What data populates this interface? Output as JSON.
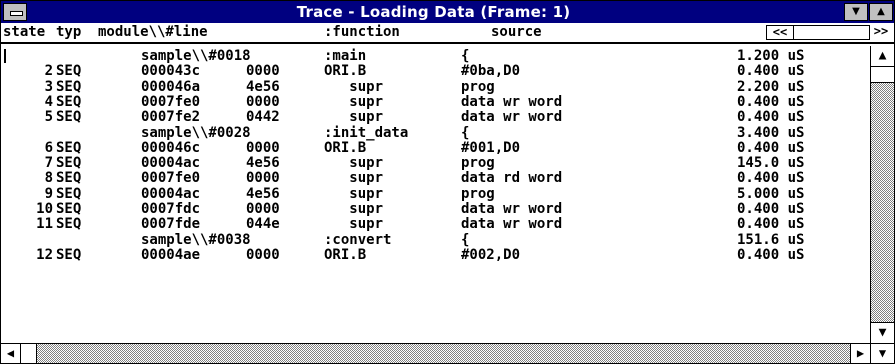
{
  "window": {
    "title": "Trace - Loading Data (Frame: 1)",
    "sys_menu_icon": "system-menu-icon",
    "minimize_glyph": "▼",
    "maximize_glyph": "▲"
  },
  "header": {
    "state": "state",
    "typ": "typ",
    "module_line": "module\\\\#line",
    "function": ":function",
    "source": "source",
    "scroll_left": "<<",
    "scroll_right": ">>"
  },
  "rows": [
    {
      "state": "",
      "typ": "",
      "addr": "sample\\\\#0018",
      "data": "",
      "op": ":main",
      "src": "{",
      "time": "1.200 uS"
    },
    {
      "state": "2",
      "typ": "SEQ",
      "addr": "000043c",
      "data": "0000",
      "op": "ORI.B",
      "src": "#0ba,D0",
      "time": "0.400 uS"
    },
    {
      "state": "3",
      "typ": "SEQ",
      "addr": "000046a",
      "data": "4e56",
      "op": "   supr",
      "src": "prog",
      "time": "2.200 uS"
    },
    {
      "state": "4",
      "typ": "SEQ",
      "addr": "0007fe0",
      "data": "0000",
      "op": "   supr",
      "src": "data wr word",
      "time": "0.400 uS"
    },
    {
      "state": "5",
      "typ": "SEQ",
      "addr": "0007fe2",
      "data": "0442",
      "op": "   supr",
      "src": "data wr word",
      "time": "0.400 uS"
    },
    {
      "state": "",
      "typ": "",
      "addr": "sample\\\\#0028",
      "data": "",
      "op": ":init_data",
      "src": "{",
      "time": "3.400 uS"
    },
    {
      "state": "6",
      "typ": "SEQ",
      "addr": "000046c",
      "data": "0000",
      "op": "ORI.B",
      "src": "#001,D0",
      "time": "0.400 uS"
    },
    {
      "state": "7",
      "typ": "SEQ",
      "addr": "00004ac",
      "data": "4e56",
      "op": "   supr",
      "src": "prog",
      "time": "145.0 uS"
    },
    {
      "state": "8",
      "typ": "SEQ",
      "addr": "0007fe0",
      "data": "0000",
      "op": "   supr",
      "src": "data rd word",
      "time": "0.400 uS"
    },
    {
      "state": "9",
      "typ": "SEQ",
      "addr": "00004ac",
      "data": "4e56",
      "op": "   supr",
      "src": "prog",
      "time": "5.000 uS"
    },
    {
      "state": "10",
      "typ": "SEQ",
      "addr": "0007fdc",
      "data": "0000",
      "op": "   supr",
      "src": "data wr word",
      "time": "0.400 uS"
    },
    {
      "state": "11",
      "typ": "SEQ",
      "addr": "0007fde",
      "data": "044e",
      "op": "   supr",
      "src": "data wr word",
      "time": "0.400 uS"
    },
    {
      "state": "",
      "typ": "",
      "addr": "sample\\\\#0038",
      "data": "",
      "op": ":convert",
      "src": "{",
      "time": "151.6 uS"
    },
    {
      "state": "12",
      "typ": "SEQ",
      "addr": "00004ae",
      "data": "0000",
      "op": "ORI.B",
      "src": "#002,D0",
      "time": "0.400 uS"
    }
  ],
  "scrollbars": {
    "up_glyph": "▲",
    "down_glyph": "▼",
    "left_glyph": "◀",
    "right_glyph": "▶"
  }
}
